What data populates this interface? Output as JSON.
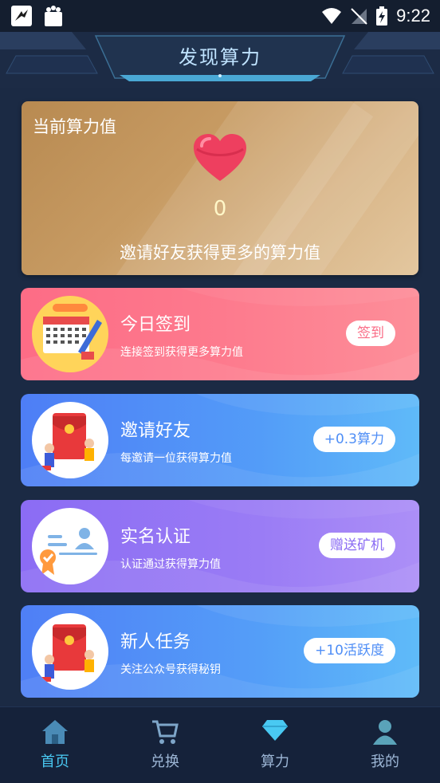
{
  "status_bar": {
    "time": "9:22"
  },
  "header": {
    "title": "发现算力"
  },
  "power_card": {
    "label": "当前算力值",
    "value": "0",
    "hint": "邀请好友获得更多的算力值"
  },
  "tasks": [
    {
      "title": "今日签到",
      "desc": "连接签到获得更多算力值",
      "button": "签到",
      "icon": "calendar-icon"
    },
    {
      "title": "邀请好友",
      "desc": "每邀请一位获得算力值",
      "button": "+0.3算力",
      "icon": "red-envelope-icon"
    },
    {
      "title": "实名认证",
      "desc": "认证通过获得算力值",
      "button": "赠送矿机",
      "icon": "id-card-icon"
    },
    {
      "title": "新人任务",
      "desc": "关注公众号获得秘钥",
      "button": "+10活跃度",
      "icon": "red-envelope-icon"
    }
  ],
  "bottom_nav": [
    {
      "label": "首页",
      "icon": "home-icon",
      "active": true
    },
    {
      "label": "兑换",
      "icon": "cart-icon",
      "active": false
    },
    {
      "label": "算力",
      "icon": "diamond-icon",
      "active": false
    },
    {
      "label": "我的",
      "icon": "user-icon",
      "active": false
    }
  ]
}
